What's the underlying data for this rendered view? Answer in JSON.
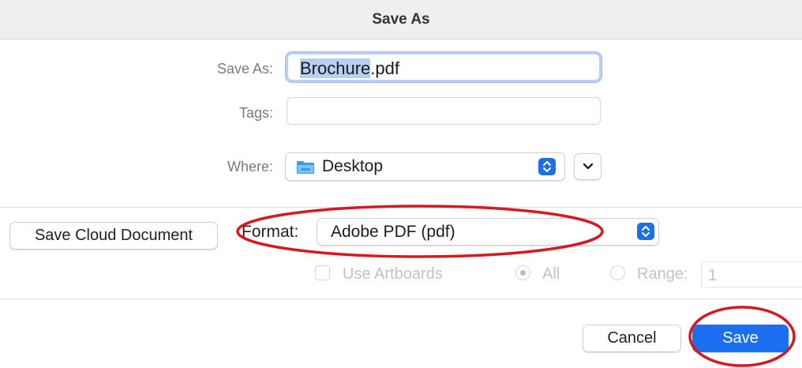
{
  "dialog": {
    "title": "Save As"
  },
  "fields": {
    "save_as_label": "Save As:",
    "filename_selected": "Brochure",
    "filename_extension": ".pdf",
    "tags_label": "Tags:",
    "tags_value": "",
    "where_label": "Where:",
    "where_value": "Desktop",
    "format_label": "Format:",
    "format_value": "Adobe PDF (pdf)"
  },
  "options": {
    "use_artboards_label": "Use Artboards",
    "use_artboards_checked": false,
    "all_label": "All",
    "range_label": "Range:",
    "range_value": "1",
    "selected_radio": "All"
  },
  "buttons": {
    "save_cloud_document": "Save Cloud Document",
    "cancel": "Cancel",
    "save": "Save"
  },
  "icons": {
    "folder": "folder-icon",
    "stepper": "updown-chevron-icon",
    "expand": "chevron-down-icon"
  },
  "colors": {
    "accent": "#1b6ff0",
    "selection": "#b6cff3",
    "annotation": "#d6191f"
  }
}
